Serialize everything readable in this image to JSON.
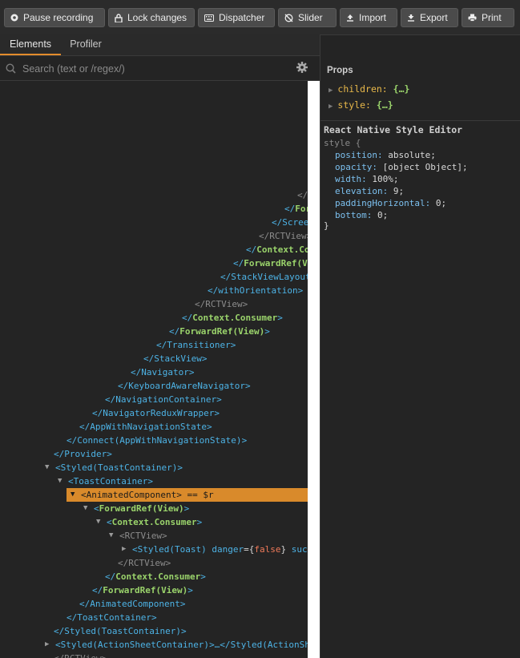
{
  "toolbar": {
    "buttons": [
      {
        "label": "Pause recording",
        "icon": "record-icon"
      },
      {
        "label": "Lock changes",
        "icon": "lock-icon"
      },
      {
        "label": "Dispatcher",
        "icon": "keyboard-icon"
      },
      {
        "label": "Slider",
        "icon": "slider-icon"
      },
      {
        "label": "Import",
        "icon": "import-icon"
      },
      {
        "label": "Export",
        "icon": "export-icon"
      },
      {
        "label": "Print",
        "icon": "print-icon"
      }
    ]
  },
  "tabs": [
    {
      "label": "Elements",
      "active": true
    },
    {
      "label": "Profiler",
      "active": false
    }
  ],
  "search": {
    "placeholder": "Search (text or /regex/)"
  },
  "tree": {
    "rows": [
      {
        "segs": [
          [
            "</",
            "gr"
          ]
        ]
      },
      {
        "segs": [
          [
            "</",
            "b"
          ],
          [
            "For",
            "g"
          ]
        ]
      },
      {
        "segs": [
          [
            "</",
            "b"
          ],
          [
            "Scree",
            "b"
          ]
        ]
      },
      {
        "segs": [
          [
            "</RCTView>",
            "gr"
          ]
        ]
      },
      {
        "segs": [
          [
            "</",
            "b"
          ],
          [
            "Context.Co",
            "g"
          ]
        ]
      },
      {
        "segs": [
          [
            "</",
            "b"
          ],
          [
            "ForwardRef(V",
            "g"
          ]
        ]
      },
      {
        "segs": [
          [
            "</",
            "b"
          ],
          [
            "StackViewLayout",
            "b"
          ]
        ]
      },
      {
        "segs": [
          [
            "</",
            "b"
          ],
          [
            "withOrientation",
            "b"
          ],
          [
            ">",
            "b"
          ]
        ]
      },
      {
        "segs": [
          [
            "</RCTView>",
            "gr"
          ]
        ]
      },
      {
        "segs": [
          [
            "</",
            "b"
          ],
          [
            "Context.Consumer",
            "g"
          ],
          [
            ">",
            "b"
          ]
        ]
      },
      {
        "segs": [
          [
            "</",
            "b"
          ],
          [
            "ForwardRef(View)",
            "g"
          ],
          [
            ">",
            "b"
          ]
        ]
      },
      {
        "segs": [
          [
            "</",
            "b"
          ],
          [
            "Transitioner",
            "b"
          ],
          [
            ">",
            "b"
          ]
        ]
      },
      {
        "segs": [
          [
            "</",
            "b"
          ],
          [
            "StackView",
            "b"
          ],
          [
            ">",
            "b"
          ]
        ]
      },
      {
        "segs": [
          [
            "</",
            "b"
          ],
          [
            "Navigator",
            "b"
          ],
          [
            ">",
            "b"
          ]
        ]
      },
      {
        "segs": [
          [
            "</",
            "b"
          ],
          [
            "KeyboardAwareNavigator",
            "b"
          ],
          [
            ">",
            "b"
          ]
        ]
      },
      {
        "segs": [
          [
            "</",
            "b"
          ],
          [
            "NavigationContainer",
            "b"
          ],
          [
            ">",
            "b"
          ]
        ]
      },
      {
        "segs": [
          [
            "</",
            "b"
          ],
          [
            "NavigatorReduxWrapper",
            "b"
          ],
          [
            ">",
            "b"
          ]
        ]
      },
      {
        "segs": [
          [
            "</",
            "b"
          ],
          [
            "AppWithNavigationState",
            "b"
          ],
          [
            ">",
            "b"
          ]
        ]
      },
      {
        "segs": [
          [
            "</",
            "b"
          ],
          [
            "Connect(AppWithNavigationState)",
            "b"
          ],
          [
            ">",
            "b"
          ]
        ]
      },
      {
        "segs": [
          [
            "</",
            "b"
          ],
          [
            "Provider",
            "b"
          ],
          [
            ">",
            "b"
          ]
        ]
      },
      {
        "segs": [
          [
            "<",
            "b"
          ],
          [
            "Styled(ToastContainer)",
            "b"
          ],
          [
            ">",
            "b"
          ]
        ],
        "arrow": "▼"
      },
      {
        "segs": [
          [
            "<",
            "b"
          ],
          [
            "ToastContainer",
            "b"
          ],
          [
            ">",
            "b"
          ]
        ],
        "arrow": "▼"
      },
      {
        "segs": [
          [
            "<AnimatedComponent>",
            "w"
          ],
          [
            " == $r",
            "gr"
          ]
        ],
        "arrow": "▼",
        "selected": true
      },
      {
        "segs": [
          [
            "<",
            "b"
          ],
          [
            "ForwardRef(View)",
            "g"
          ],
          [
            ">",
            "b"
          ]
        ],
        "arrow": "▼"
      },
      {
        "segs": [
          [
            "<",
            "b"
          ],
          [
            "Context.Consumer",
            "g"
          ],
          [
            ">",
            "b"
          ]
        ],
        "arrow": "▼"
      },
      {
        "segs": [
          [
            "<RCTView>",
            "gr"
          ]
        ],
        "arrow": "▼"
      },
      {
        "segs": [
          [
            "<",
            "b"
          ],
          [
            "Styled(Toast)",
            "b"
          ],
          [
            " danger",
            "b"
          ],
          [
            "=",
            "w"
          ],
          [
            "{",
            "w"
          ],
          [
            "false",
            "r"
          ],
          [
            "}",
            "w"
          ],
          [
            " succ",
            "b"
          ]
        ],
        "arrow": "▶"
      },
      {
        "segs": [
          [
            "</RCTView>",
            "gr"
          ]
        ]
      },
      {
        "segs": [
          [
            "</",
            "b"
          ],
          [
            "Context.Consumer",
            "g"
          ],
          [
            ">",
            "b"
          ]
        ]
      },
      {
        "segs": [
          [
            "</",
            "b"
          ],
          [
            "ForwardRef(View)",
            "g"
          ],
          [
            ">",
            "b"
          ]
        ]
      },
      {
        "segs": [
          [
            "</",
            "b"
          ],
          [
            "AnimatedComponent",
            "b"
          ],
          [
            ">",
            "b"
          ]
        ]
      },
      {
        "segs": [
          [
            "</",
            "b"
          ],
          [
            "ToastContainer",
            "b"
          ],
          [
            ">",
            "b"
          ]
        ]
      },
      {
        "segs": [
          [
            "</",
            "b"
          ],
          [
            "Styled(ToastContainer)",
            "b"
          ],
          [
            ">",
            "b"
          ]
        ]
      },
      {
        "segs": [
          [
            "<",
            "b"
          ],
          [
            "Styled(ActionSheetContainer)",
            "b"
          ],
          [
            ">…</",
            "b"
          ],
          [
            "Styled(ActionSh",
            "b"
          ]
        ],
        "arrow": "▶"
      },
      {
        "segs": [
          [
            "</RCTView>",
            "gr"
          ]
        ]
      }
    ]
  },
  "props": {
    "title": "Props",
    "items": [
      {
        "key": "children:",
        "value": "{…}"
      },
      {
        "key": "style:",
        "value": "{…}"
      }
    ]
  },
  "style_editor": {
    "title": "React Native Style Editor",
    "open": "style {",
    "close": "}",
    "lines": [
      {
        "key": "position:",
        "value": "absolute;"
      },
      {
        "key": "opacity:",
        "value": "[object Object];"
      },
      {
        "key": "width:",
        "value": "100%;"
      },
      {
        "key": "elevation:",
        "value": "9;"
      },
      {
        "key": "paddingHorizontal:",
        "value": "0;"
      },
      {
        "key": "bottom:",
        "value": "0;"
      }
    ]
  }
}
